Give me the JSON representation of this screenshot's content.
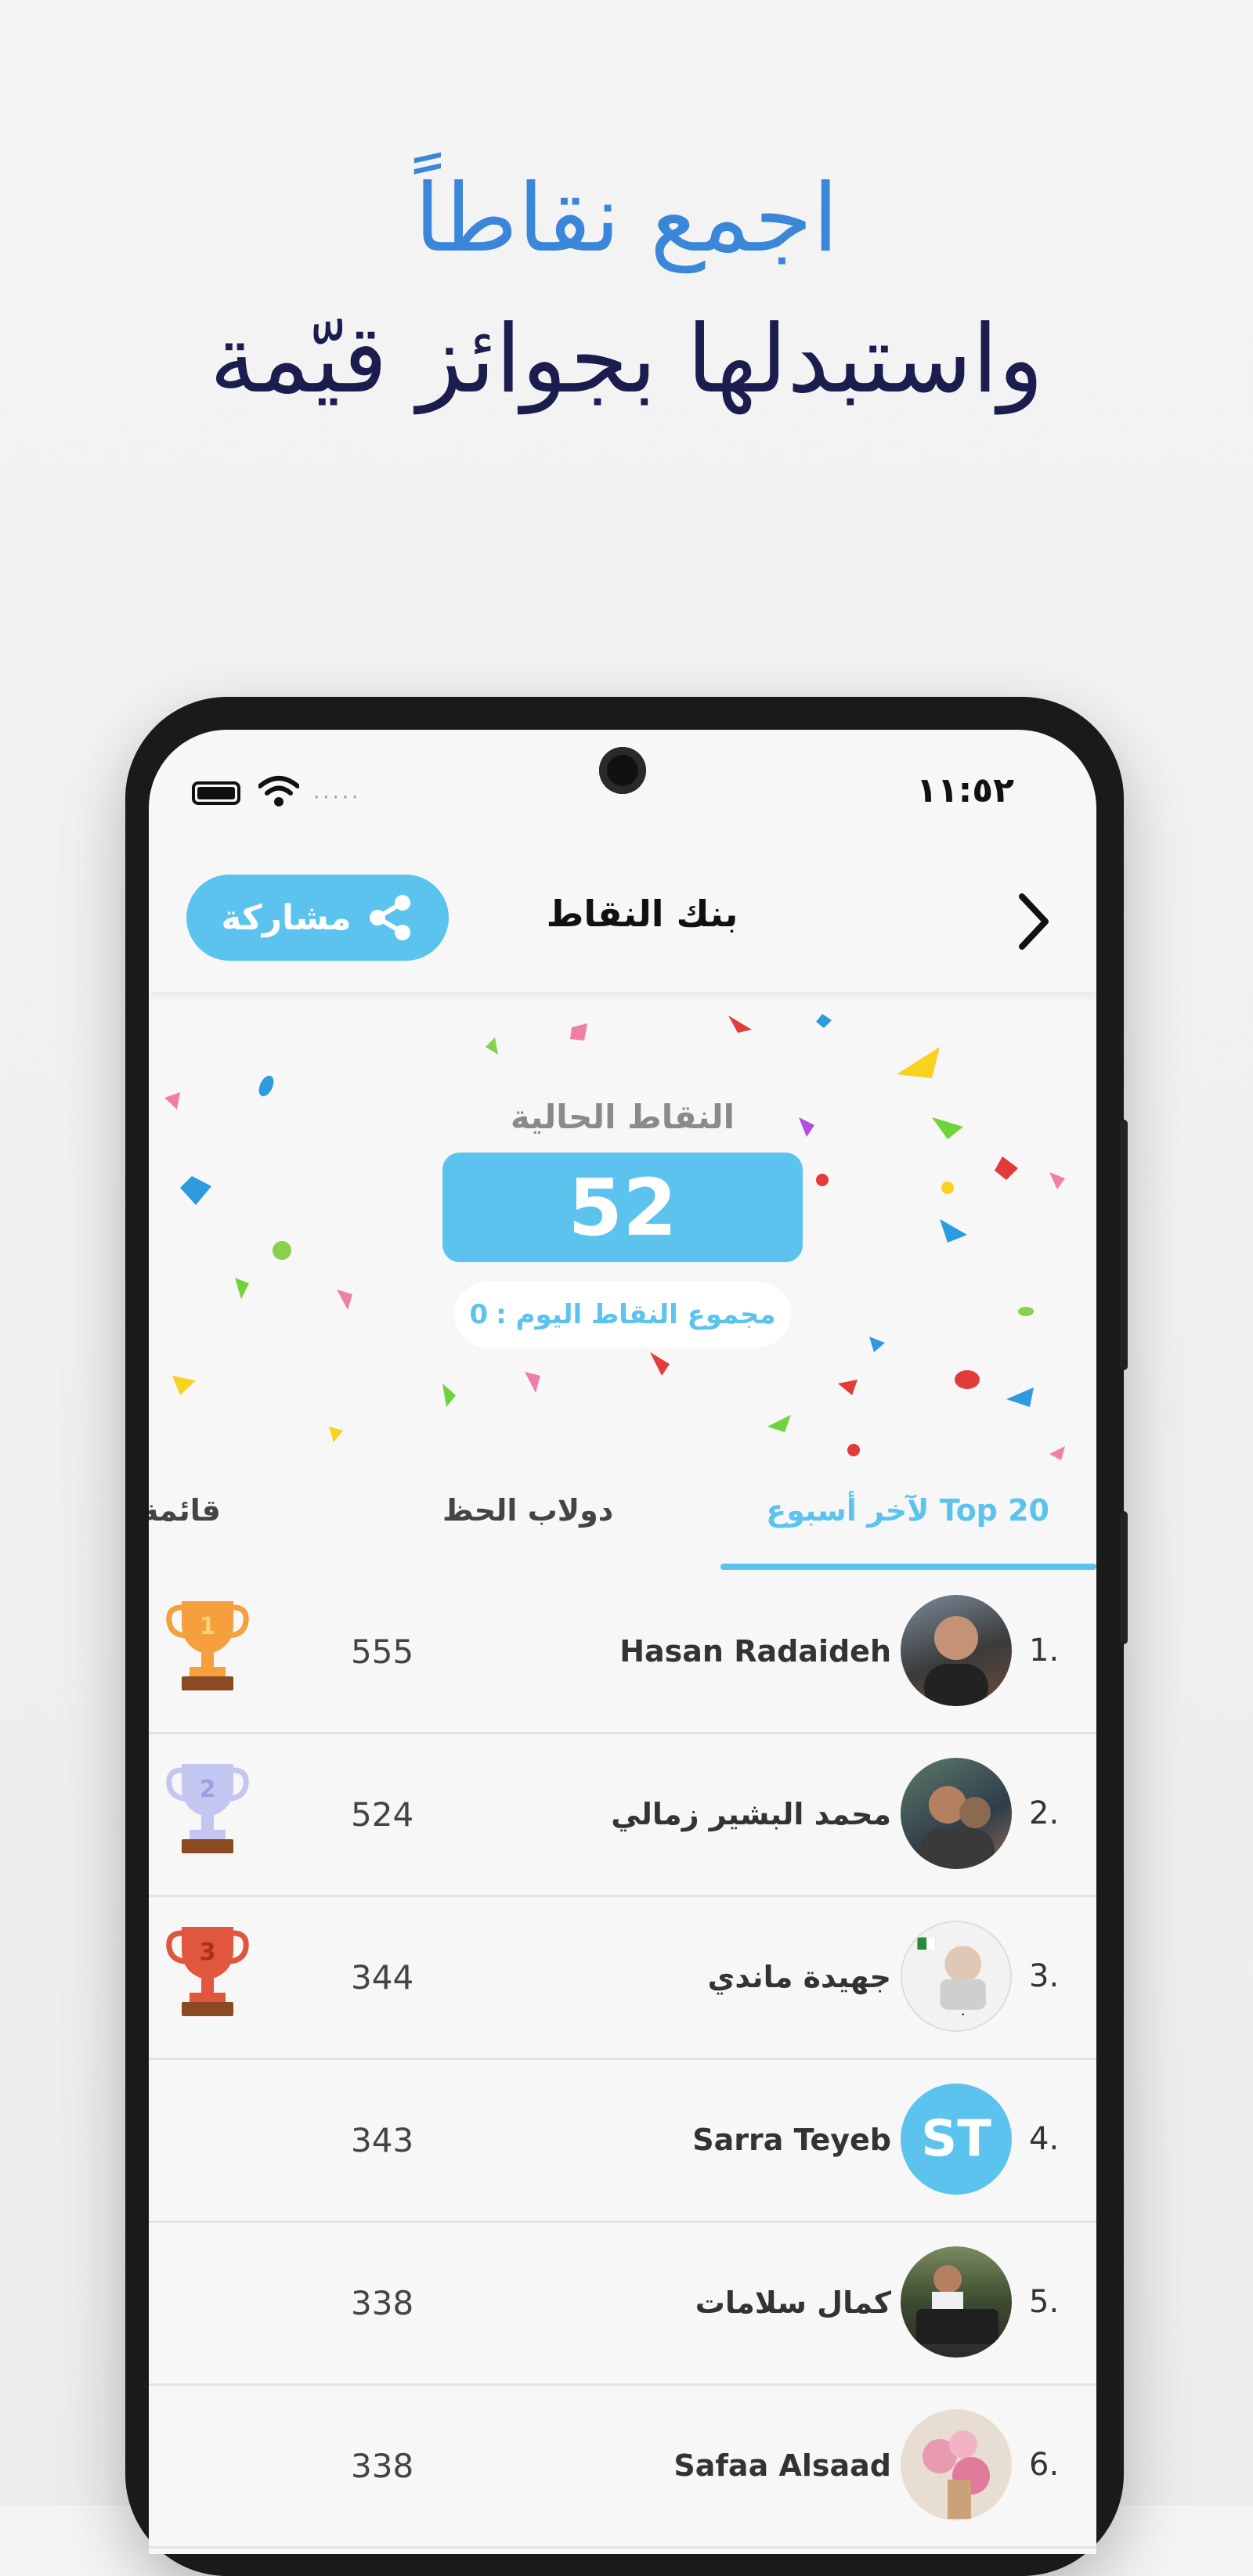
{
  "promo": {
    "line1": "اجمع نقاطاً",
    "line2": "واستبدلها بجوائز قيّمة"
  },
  "status_bar": {
    "time": "١١:٥٢",
    "dots": "·····"
  },
  "header": {
    "title": "بنك النقاط",
    "share_label": "مشاركة"
  },
  "points": {
    "label": "النقاط الحالية",
    "value": "52",
    "today_label": "مجموع النقاط اليوم :",
    "today_value": "0"
  },
  "tabs": [
    {
      "label": "Top 20 لآخر أسبوع",
      "active": true
    },
    {
      "label": "دولاب الحظ",
      "active": false
    },
    {
      "label": "قائمة",
      "active": false
    }
  ],
  "leaderboard": [
    {
      "rank": "1.",
      "name": "Hasan Radaideh",
      "score": "555",
      "trophy": "gold-trophy",
      "avatar": "photo"
    },
    {
      "rank": "2.",
      "name": "محمد البشير زمالي",
      "score": "524",
      "trophy": "silver-trophy",
      "avatar": "photo"
    },
    {
      "rank": "3.",
      "name": "جهيدة ماندي",
      "score": "344",
      "trophy": "bronze-trophy",
      "avatar": "photo"
    },
    {
      "rank": "4.",
      "name": "Sarra Teyeb",
      "score": "343",
      "avatar_initials": "ST"
    },
    {
      "rank": "5.",
      "name": "كمال سلامات",
      "score": "338",
      "avatar": "photo"
    },
    {
      "rank": "6.",
      "name": "Safaa Alsaad",
      "score": "338",
      "avatar": "photo"
    }
  ],
  "colors": {
    "accent": "#5bc3ee",
    "promo_blue": "#3a86d8",
    "promo_navy": "#1c1d4f"
  }
}
